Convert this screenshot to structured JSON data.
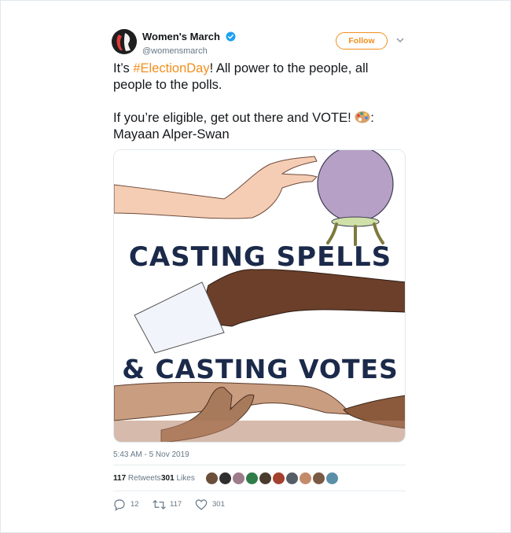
{
  "account": {
    "display_name": "Women's March",
    "handle": "@womensmarch",
    "verified": true,
    "avatar_icon": "womens-march-logo"
  },
  "follow_label": "Follow",
  "tweet": {
    "text_before_hashtag": "It’s ",
    "hashtag": "#ElectionDay",
    "text_after_hashtag": "! All power to the people, all people to the polls.\n\nIf you’re eligible, get out there and VOTE! ",
    "emoji_icon": "artist-palette-icon",
    "text_after_emoji": ":\nMayaan Alper-Swan"
  },
  "media": {
    "line1": "CASTING SPELLS",
    "line2": "& CASTING VOTES",
    "text_color": "#1b2a4a"
  },
  "timestamp": "5:43 AM - 5 Nov 2019",
  "stats": {
    "retweets_count": "117",
    "retweets_label": "Retweets",
    "likes_count": "301",
    "likes_label": "Likes"
  },
  "actions": {
    "reply_count": "12",
    "retweet_count": "117",
    "like_count": "301"
  },
  "colors": {
    "accent": "#f28e1c",
    "verified": "#1da1f2",
    "muted": "#657786"
  }
}
